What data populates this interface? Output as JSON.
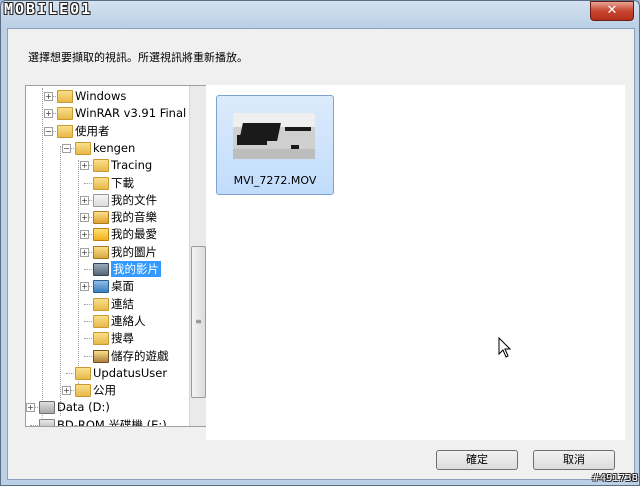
{
  "window": {
    "logo_text": "MOBILE01",
    "close_label": "✕"
  },
  "instruction": "選擇想要擷取的視訊。所選視訊將重新播放。",
  "tree": {
    "items": [
      {
        "label": "Windows",
        "depth": 2,
        "expander": "+",
        "icon": "folder"
      },
      {
        "label": "WinRAR v3.91 Final",
        "depth": 2,
        "expander": "+",
        "icon": "folder"
      },
      {
        "label": "使用者",
        "depth": 2,
        "expander": "−",
        "icon": "folder"
      },
      {
        "label": "kengen",
        "depth": 3,
        "expander": "−",
        "icon": "folder"
      },
      {
        "label": "Tracing",
        "depth": 4,
        "expander": "+",
        "icon": "folder"
      },
      {
        "label": "下載",
        "depth": 4,
        "expander": "",
        "icon": "downloads"
      },
      {
        "label": "我的文件",
        "depth": 4,
        "expander": "+",
        "icon": "documents"
      },
      {
        "label": "我的音樂",
        "depth": 4,
        "expander": "+",
        "icon": "music"
      },
      {
        "label": "我的最愛",
        "depth": 4,
        "expander": "+",
        "icon": "favorites"
      },
      {
        "label": "我的圖片",
        "depth": 4,
        "expander": "+",
        "icon": "pictures"
      },
      {
        "label": "我的影片",
        "depth": 4,
        "expander": "",
        "icon": "videos",
        "selected": true
      },
      {
        "label": "桌面",
        "depth": 4,
        "expander": "+",
        "icon": "desktop"
      },
      {
        "label": "連結",
        "depth": 4,
        "expander": "",
        "icon": "links"
      },
      {
        "label": "連絡人",
        "depth": 4,
        "expander": "",
        "icon": "contacts"
      },
      {
        "label": "搜尋",
        "depth": 4,
        "expander": "",
        "icon": "search"
      },
      {
        "label": "儲存的遊戲",
        "depth": 4,
        "expander": "",
        "icon": "saved-games"
      },
      {
        "label": "UpdatusUser",
        "depth": 3,
        "expander": "",
        "icon": "folder"
      },
      {
        "label": "公用",
        "depth": 3,
        "expander": "+",
        "icon": "folder"
      },
      {
        "label": "Data (D:)",
        "depth": 1,
        "expander": "+",
        "icon": "drive"
      },
      {
        "label": "BD-ROM 光碟機 (E:)",
        "depth": 1,
        "expander": "",
        "icon": "optical-drive"
      }
    ]
  },
  "content": {
    "files": [
      {
        "name": "MVI_7272.MOV",
        "icon": "video-thumbnail"
      }
    ]
  },
  "buttons": {
    "ok": "確定",
    "cancel": "取消"
  },
  "watermark": "#491738",
  "colors": {
    "selection": "#3399ff",
    "close_button": "#c7462f",
    "tile_border": "#7da2ce"
  }
}
